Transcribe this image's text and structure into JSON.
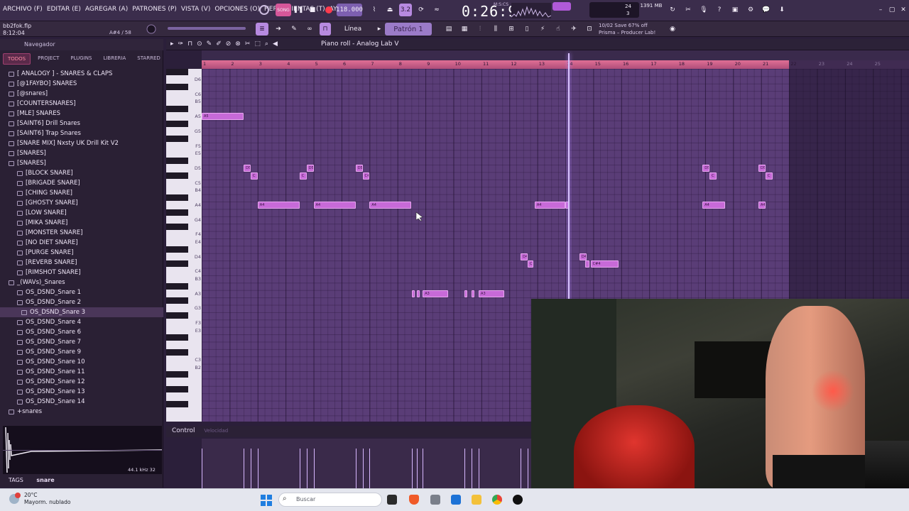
{
  "menu": [
    "ARCHIVO (F)",
    "EDITAR (E)",
    "AGREGAR (A)",
    "PATRONES (P)",
    "VISTA (V)",
    "OPCIONES (O)",
    "HERRAMIENTAS (T)",
    "AYUDA"
  ],
  "transport": {
    "tempo": "118.000",
    "time": "0:26:91",
    "time_unit": "M:S:CS",
    "memory": "1391 MB",
    "cpu": "24",
    "threads": "3",
    "mode_label": "3.2"
  },
  "project": {
    "file": "bb2fok.flp",
    "position": "8:12:04",
    "note_readout": "A#4 / 58"
  },
  "toolbar2": {
    "snap_label": "Línea",
    "pattern_label": "Patrón 1"
  },
  "hint": {
    "line1": "10/02  Save 67% off",
    "line2": "Prisma – Producer Lab!"
  },
  "browser": {
    "title": "Navegador",
    "tabs": [
      "TODOS",
      "PROJECT",
      "PLUGINS",
      "LIBRERIA",
      "STARRED"
    ],
    "items": [
      {
        "label": "[ ANALOGY ] - SNARES & CLAPS",
        "indent": 1
      },
      {
        "label": "[@1FAYBO] SNARES",
        "indent": 1
      },
      {
        "label": "[@snares]",
        "indent": 1
      },
      {
        "label": "[COUNTERSNARES]",
        "indent": 1
      },
      {
        "label": "[MLE] SNARES",
        "indent": 1
      },
      {
        "label": "[SAINT6] Drill Snares",
        "indent": 1
      },
      {
        "label": "[SAINT6] Trap Snares",
        "indent": 1
      },
      {
        "label": "[SNARE MIX] Nxsty UK Drill Kit V2",
        "indent": 1
      },
      {
        "label": "[SNARES]",
        "indent": 1
      },
      {
        "label": "[SNARES]",
        "indent": 1
      },
      {
        "label": "[BLOCK SNARE]",
        "indent": 2
      },
      {
        "label": "[BRIGADE SNARE]",
        "indent": 2
      },
      {
        "label": "[CHING SNARE]",
        "indent": 2
      },
      {
        "label": "[GHOSTY SNARE]",
        "indent": 2
      },
      {
        "label": "[LOW SNARE]",
        "indent": 2
      },
      {
        "label": "[MIKA SNARE]",
        "indent": 2
      },
      {
        "label": "[MONSTER SNARE]",
        "indent": 2
      },
      {
        "label": "[NO DIET SNARE]",
        "indent": 2
      },
      {
        "label": "[PURGE SNARE]",
        "indent": 2
      },
      {
        "label": "[REVERB SNARE]",
        "indent": 2
      },
      {
        "label": "[RIMSHOT SNARE]",
        "indent": 2
      },
      {
        "label": "_(WAVs)_Snares",
        "indent": 1
      },
      {
        "label": "OS_DSND_Snare 1",
        "indent": 2
      },
      {
        "label": "OS_DSND_Snare 2",
        "indent": 2
      },
      {
        "label": "OS_DSND_Snare 3",
        "indent": 3,
        "selected": true
      },
      {
        "label": "OS_DSND_Snare 4",
        "indent": 2
      },
      {
        "label": "OS_DSND_Snare 6",
        "indent": 2
      },
      {
        "label": "OS_DSND_Snare 7",
        "indent": 2
      },
      {
        "label": "OS_DSND_Snare 9",
        "indent": 2
      },
      {
        "label": "OS_DSND_Snare 10",
        "indent": 2
      },
      {
        "label": "OS_DSND_Snare 11",
        "indent": 2
      },
      {
        "label": "OS_DSND_Snare 12",
        "indent": 2
      },
      {
        "label": "OS_DSND_Snare 13",
        "indent": 2
      },
      {
        "label": "OS_DSND_Snare 14",
        "indent": 2
      },
      {
        "label": "+snares",
        "indent": 1
      }
    ],
    "sample_info": "44.1 kHz 32",
    "tags_label": "TAGS",
    "tag_value": "snare"
  },
  "piano_roll": {
    "title": "Piano roll - Analog Lab V",
    "bars": [
      "1",
      "2",
      "3",
      "4",
      "5",
      "6",
      "7",
      "8",
      "9",
      "10",
      "11",
      "12",
      "13",
      "14",
      "15",
      "16",
      "17",
      "18",
      "19",
      "20",
      "21",
      "22",
      "23",
      "24",
      "25"
    ],
    "key_labels": [
      "D6",
      "C6",
      "B5",
      "A5",
      "G5",
      "F5",
      "E5",
      "D5",
      "C5",
      "B4",
      "A4",
      "G4",
      "F4",
      "E4",
      "D4",
      "C4",
      "B3",
      "A3",
      "G3",
      "F3",
      "E3",
      "C3",
      "B2"
    ],
    "notes": [
      {
        "label": "A5",
        "key": "A5",
        "start": 1.0,
        "length": 1.5
      },
      {
        "label": "D5",
        "key": "D5",
        "start": 2.5,
        "length": 0.25
      },
      {
        "label": "C",
        "key": "C#5",
        "start": 2.75,
        "length": 0.25
      },
      {
        "label": "D5",
        "key": "D5",
        "start": 4.75,
        "length": 0.25
      },
      {
        "label": "C",
        "key": "C#5",
        "start": 4.5,
        "length": 0.25
      },
      {
        "label": "D5",
        "key": "D5",
        "start": 6.5,
        "length": 0.25
      },
      {
        "label": "C#5",
        "key": "C#5",
        "start": 6.75,
        "length": 0.25
      },
      {
        "label": "A4",
        "key": "A4",
        "start": 3.0,
        "length": 1.5
      },
      {
        "label": "A4",
        "key": "A4",
        "start": 5.0,
        "length": 1.5
      },
      {
        "label": "A4",
        "key": "A4",
        "start": 7.0,
        "length": 1.5
      },
      {
        "label": "A4",
        "key": "A4",
        "start": 12.9,
        "length": 1.1
      },
      {
        "label": "",
        "key": "A4",
        "start": 14.0,
        "length": 0.15
      },
      {
        "label": "A4",
        "key": "A4",
        "start": 18.9,
        "length": 0.8
      },
      {
        "label": "A4",
        "key": "A4",
        "start": 20.9,
        "length": 0.25
      },
      {
        "label": "D5",
        "key": "D5",
        "start": 18.9,
        "length": 0.25
      },
      {
        "label": "C",
        "key": "C#5",
        "start": 19.15,
        "length": 0.25
      },
      {
        "label": "D5",
        "key": "D5",
        "start": 20.9,
        "length": 0.25
      },
      {
        "label": "C",
        "key": "C#5",
        "start": 21.15,
        "length": 0.25
      },
      {
        "label": "D4",
        "key": "D4",
        "start": 12.4,
        "length": 0.25
      },
      {
        "label": "C",
        "key": "C#4",
        "start": 12.65,
        "length": 0.2
      },
      {
        "label": "D4",
        "key": "D4",
        "start": 14.5,
        "length": 0.25
      },
      {
        "label": "",
        "key": "C#4",
        "start": 14.7,
        "length": 0.15
      },
      {
        "label": "C#4",
        "key": "C#4",
        "start": 14.9,
        "length": 1.0
      },
      {
        "label": "",
        "key": "A3",
        "start": 8.5,
        "length": 0.1
      },
      {
        "label": "",
        "key": "A3",
        "start": 8.7,
        "length": 0.1
      },
      {
        "label": "A3",
        "key": "A3",
        "start": 8.9,
        "length": 0.9
      },
      {
        "label": "",
        "key": "A3",
        "start": 10.4,
        "length": 0.1
      },
      {
        "label": "",
        "key": "A3",
        "start": 10.65,
        "length": 0.1
      },
      {
        "label": "A3",
        "key": "A3",
        "start": 10.9,
        "length": 0.9
      }
    ],
    "playhead_bar": 14.1,
    "loop_end_bar": 22.0,
    "control_label": "Control",
    "control_sub": "Velocidad"
  },
  "taskbar": {
    "temp": "20°C",
    "weather": "Mayorm. nublado",
    "search": "Buscar"
  },
  "colors": {
    "accent": "#c76ad8",
    "grid": "#5a3d77",
    "ruler": "#e06f94"
  }
}
